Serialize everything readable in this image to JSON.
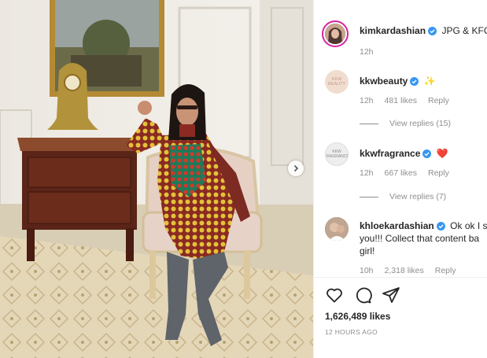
{
  "post": {
    "author": "kimkardashian",
    "caption": "JPG & KFC",
    "time_ago": "12h"
  },
  "comments": [
    {
      "username": "kkwbeauty",
      "text": "✨",
      "time": "12h",
      "likes": "481 likes",
      "reply": "Reply",
      "avatar_text": "KKW BEAUTY",
      "view_replies": "View replies (15)"
    },
    {
      "username": "kkwfragrance",
      "text": "❤️",
      "time": "12h",
      "likes": "667 likes",
      "reply": "Reply",
      "avatar_text": "KKW FRAGRANCE",
      "view_replies": "View replies (7)"
    },
    {
      "username": "khloekardashian",
      "text_line1": "Ok ok I se",
      "text_line2": "you!!! Collect that content ba",
      "text_line3": "girl!",
      "time": "10h",
      "likes": "2,318 likes",
      "reply": "Reply"
    }
  ],
  "actions": {
    "like_icon": "heart-icon",
    "comment_icon": "comment-icon",
    "share_icon": "paper-plane-icon"
  },
  "footer": {
    "likes": "1,626,489 likes",
    "timestamp": "12 HOURS AGO"
  },
  "colors": {
    "verified": "#3897f0",
    "muted": "#8e8e8e",
    "text": "#262626"
  }
}
